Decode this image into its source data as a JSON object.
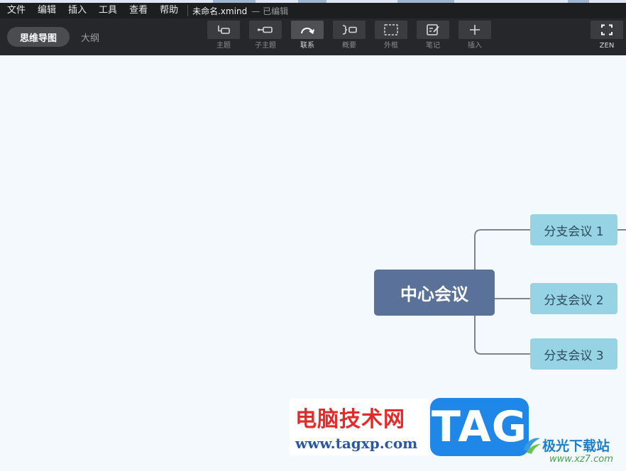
{
  "menu": {
    "items": [
      "文件",
      "编辑",
      "插入",
      "工具",
      "查看",
      "帮助"
    ],
    "doc_title": "未命名.xmind",
    "doc_status": "— 已编辑"
  },
  "view_tabs": {
    "mindmap": "思维导图",
    "outline": "大纲",
    "active": "思维导图"
  },
  "toolbar": {
    "tools": [
      {
        "label": "主题",
        "icon": "topic-icon"
      },
      {
        "label": "子主题",
        "icon": "subtopic-icon"
      },
      {
        "label": "联系",
        "icon": "relationship-icon"
      },
      {
        "label": "概要",
        "icon": "summary-icon"
      },
      {
        "label": "外框",
        "icon": "boundary-icon"
      },
      {
        "label": "笔记",
        "icon": "note-icon"
      },
      {
        "label": "插入",
        "icon": "plus-icon"
      }
    ],
    "active": "联系",
    "zen": {
      "label": "ZEN",
      "icon": "fullscreen-icon"
    }
  },
  "mindmap": {
    "central": "中心会议",
    "branches": [
      "分支会议 1",
      "分支会议 2",
      "分支会议 3"
    ]
  },
  "watermark": {
    "cn_text": "电脑技术网",
    "url": "www.tagxp.com",
    "tag": "TAG",
    "xz_name": "极光下载站",
    "xz_url": "www.xz7.com"
  },
  "colors": {
    "central_topic": "#5a7199",
    "branch_topic": "#96d3e5",
    "canvas_bg": "#f4f9fd",
    "toolbar_bg": "#25272a",
    "menubar_bg": "#1c1e20"
  }
}
